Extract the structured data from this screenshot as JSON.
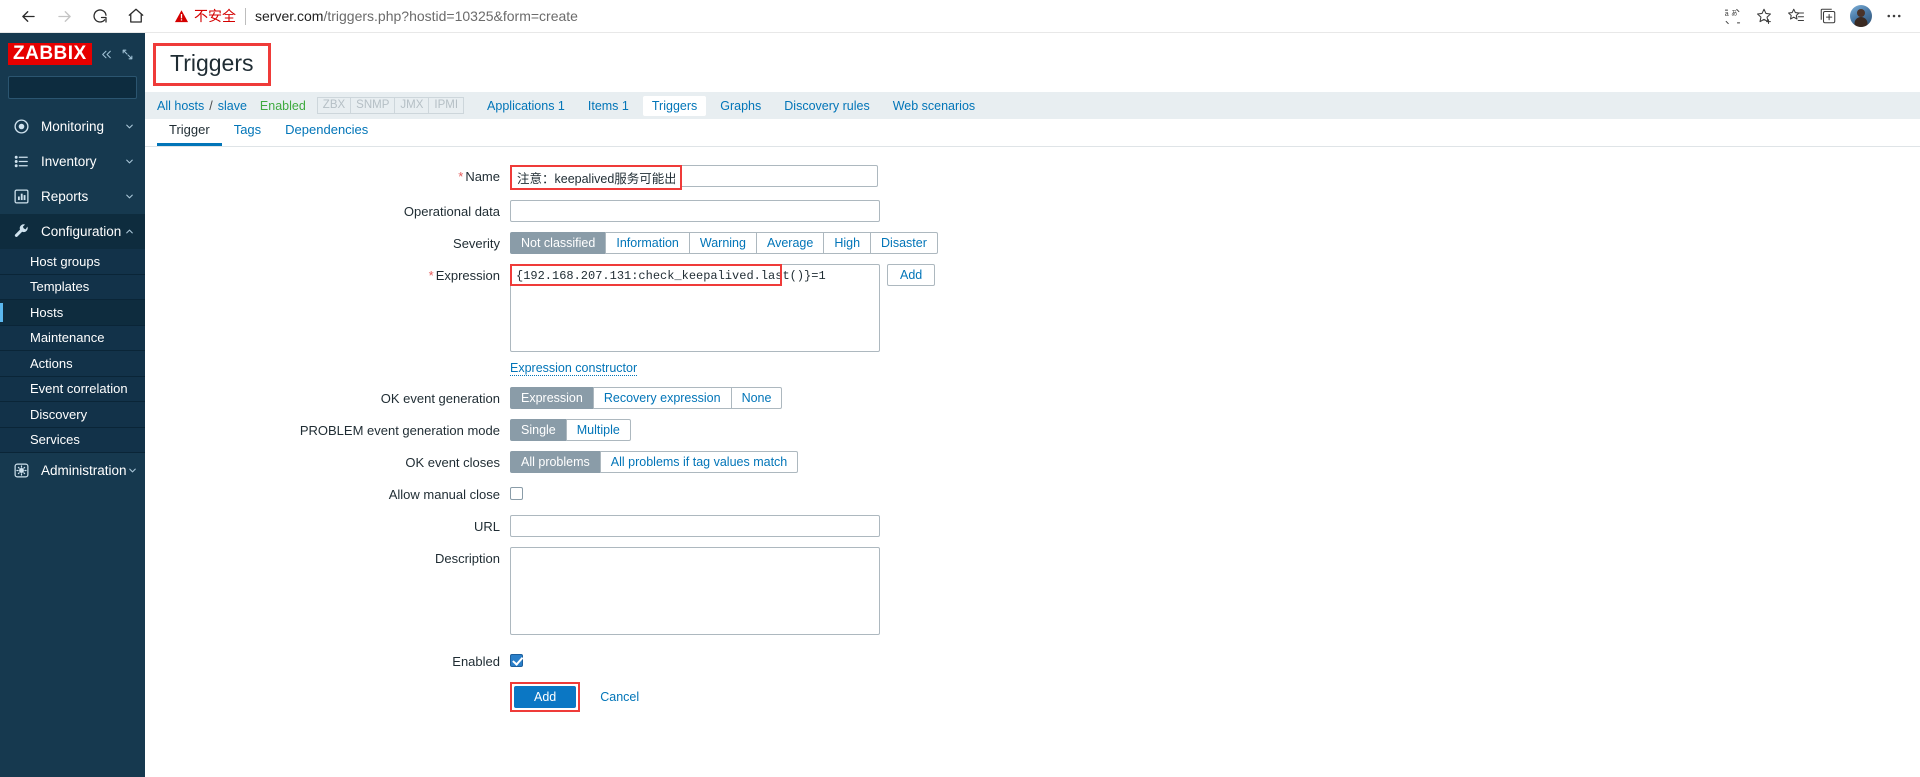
{
  "browser": {
    "back_icon": "back-arrow-icon",
    "forward_icon": "forward-arrow-icon",
    "reload_icon": "reload-icon",
    "home_icon": "home-icon",
    "security_label": "不安全",
    "url_main": "server.com",
    "url_path": "/triggers.php?hostid=10325&form=create",
    "translate_icon": "translate-icon",
    "favorite_icon": "star-add-icon",
    "collections_icon": "favorites-list-icon",
    "tabs_icon": "browser-tabs-icon",
    "profile_icon": "avatar",
    "more_icon": "more-options-icon"
  },
  "sidebar": {
    "logo": "ZABBIX",
    "collapse_icon": "collapse-double-chevron-icon",
    "hide_icon": "hide-sidebar-icon",
    "search_placeholder": "",
    "search_value": "",
    "search_icon": "search-icon",
    "items": [
      {
        "label": "Monitoring",
        "icon": "eye-icon",
        "chevron": true,
        "active": false
      },
      {
        "label": "Inventory",
        "icon": "list-icon",
        "chevron": true,
        "active": false
      },
      {
        "label": "Reports",
        "icon": "bar-chart-icon",
        "chevron": true,
        "active": false
      },
      {
        "label": "Configuration",
        "icon": "wrench-icon",
        "chevron": true,
        "active": true
      }
    ],
    "submenu": [
      {
        "label": "Host groups",
        "selected": false
      },
      {
        "label": "Templates",
        "selected": false
      },
      {
        "label": "Hosts",
        "selected": true
      },
      {
        "label": "Maintenance",
        "selected": false
      },
      {
        "label": "Actions",
        "selected": false
      },
      {
        "label": "Event correlation",
        "selected": false
      },
      {
        "label": "Discovery",
        "selected": false
      },
      {
        "label": "Services",
        "selected": false
      }
    ],
    "admin": {
      "label": "Administration",
      "icon": "gear-icon",
      "chevron": true
    }
  },
  "header": {
    "title": "Triggers"
  },
  "breadcrumb": {
    "all_hosts": "All hosts",
    "separator": "/",
    "host": "slave",
    "status": "Enabled",
    "protocols": [
      "ZBX",
      "SNMP",
      "JMX",
      "IPMI"
    ],
    "links": [
      {
        "label": "Applications 1",
        "selected": false
      },
      {
        "label": "Items 1",
        "selected": false
      },
      {
        "label": "Triggers",
        "selected": true
      },
      {
        "label": "Graphs",
        "selected": false
      },
      {
        "label": "Discovery rules",
        "selected": false
      },
      {
        "label": "Web scenarios",
        "selected": false
      }
    ]
  },
  "tabs": [
    {
      "label": "Trigger",
      "active": true
    },
    {
      "label": "Tags",
      "active": false
    },
    {
      "label": "Dependencies",
      "active": false
    }
  ],
  "form": {
    "name": {
      "label": "Name",
      "required": true,
      "value": "注意：keepalived服务可能出现脑裂",
      "placeholder": ""
    },
    "operational_data": {
      "label": "Operational data",
      "value": "",
      "placeholder": ""
    },
    "severity": {
      "label": "Severity",
      "options": [
        "Not classified",
        "Information",
        "Warning",
        "Average",
        "High",
        "Disaster"
      ],
      "selected": "Not classified"
    },
    "expression": {
      "label": "Expression",
      "required": true,
      "value": "{192.168.207.131:check_keepalived.last()}=1",
      "add_button": "Add",
      "constructor_link": "Expression constructor"
    },
    "ok_event_generation": {
      "label": "OK event generation",
      "options": [
        "Expression",
        "Recovery expression",
        "None"
      ],
      "selected": "Expression"
    },
    "problem_event_generation_mode": {
      "label": "PROBLEM event generation mode",
      "options": [
        "Single",
        "Multiple"
      ],
      "selected": "Single"
    },
    "ok_event_closes": {
      "label": "OK event closes",
      "options": [
        "All problems",
        "All problems if tag values match"
      ],
      "selected": "All problems"
    },
    "allow_manual_close": {
      "label": "Allow manual close",
      "checked": false
    },
    "url": {
      "label": "URL",
      "value": "",
      "placeholder": ""
    },
    "description": {
      "label": "Description",
      "value": "",
      "placeholder": ""
    },
    "enabled": {
      "label": "Enabled",
      "checked": true
    },
    "actions": {
      "submit": "Add",
      "cancel": "Cancel"
    }
  },
  "colors": {
    "brand_red": "#e60000",
    "sidebar_bg": "#16394f",
    "accent_blue": "#0275b8",
    "highlight_red": "#ef3b39",
    "primary_button": "#0b77c4"
  }
}
